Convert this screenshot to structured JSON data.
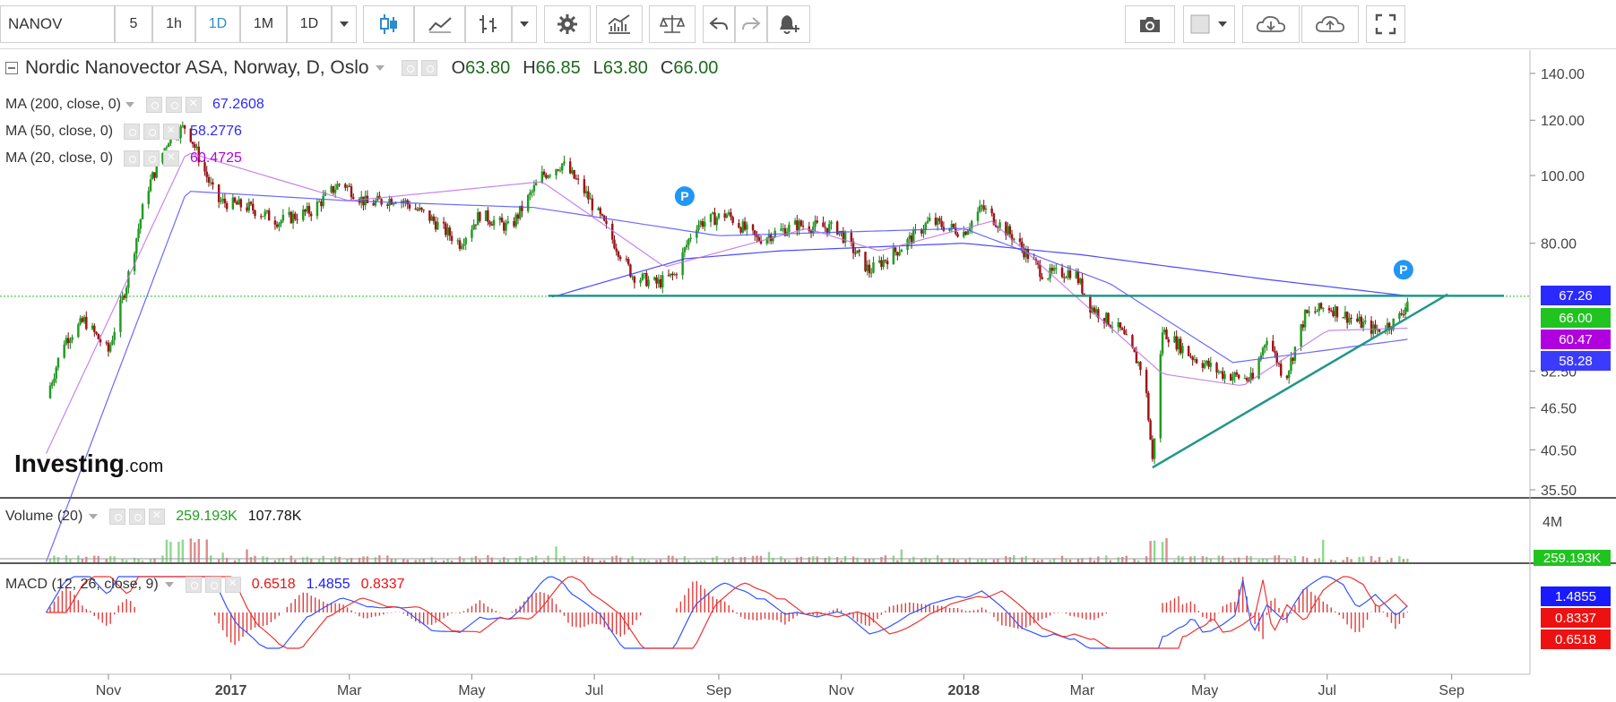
{
  "toolbar": {
    "symbol": "NANOV",
    "intervals": [
      "5",
      "1h",
      "1D",
      "1M",
      "1D"
    ],
    "active_interval": "1D"
  },
  "header": {
    "title": "Nordic Nanovector ASA, Norway, D, Oslo",
    "o_label": "O",
    "o_value": "63.80",
    "h_label": "H",
    "h_value": "66.85",
    "l_label": "L",
    "l_value": "63.80",
    "c_label": "C",
    "c_value": "66.00"
  },
  "indicators": {
    "ma200": {
      "label": "MA (200, close, 0)",
      "value": "67.2608",
      "color": "#2a2aff"
    },
    "ma50": {
      "label": "MA (50, close, 0)",
      "value": "58.2776",
      "color": "#2a2aff"
    },
    "ma20": {
      "label": "MA (20, close, 0)",
      "value": "60.4725",
      "color": "#b000e0"
    },
    "volume": {
      "label": "Volume (20)",
      "value1": "259.193K",
      "value2": "107.78K"
    },
    "macd": {
      "label": "MACD (12, 26, close, 9)",
      "value1": "0.6518",
      "value2": "1.4855",
      "value3": "0.8337"
    }
  },
  "price_tags": [
    {
      "text": "67.26",
      "bg": "#2a2aff"
    },
    {
      "text": "66.00",
      "bg": "#21c321"
    },
    {
      "text": "60.47",
      "bg": "#b000e0"
    },
    {
      "text": "58.28",
      "bg": "#3b3bff"
    }
  ],
  "volume_tag": {
    "text": "259.193K",
    "bg": "#21c321"
  },
  "macd_tags": [
    {
      "text": "1.4855",
      "bg": "#1a1aff"
    },
    {
      "text": "0.8337",
      "bg": "#ee1111"
    },
    {
      "text": "0.6518",
      "bg": "#ee1111"
    }
  ],
  "logo": {
    "brand": "Investing",
    "suffix": ".com"
  },
  "chart_data": {
    "type": "candlestick",
    "y_scale": "log",
    "y_ticks": [
      "140.00",
      "120.00",
      "100.00",
      "80.00",
      "52.50",
      "46.50",
      "40.50",
      "35.50"
    ],
    "x_ticks": [
      "Nov",
      "2017",
      "Mar",
      "May",
      "Jul",
      "Sep",
      "Nov",
      "2018",
      "Mar",
      "May",
      "Jul",
      "Sep"
    ],
    "volume_ticks": [
      "4M"
    ],
    "last": {
      "open": 63.8,
      "high": 66.85,
      "low": 63.8,
      "close": 66.0
    },
    "price_path": [
      [
        "2016-10-01",
        48
      ],
      [
        "2016-10-10",
        58
      ],
      [
        "2016-10-20",
        62
      ],
      [
        "2016-11-01",
        56
      ],
      [
        "2016-11-10",
        70
      ],
      [
        "2016-11-20",
        95
      ],
      [
        "2016-12-01",
        113
      ],
      [
        "2016-12-10",
        118
      ],
      [
        "2016-12-15",
        108
      ],
      [
        "2016-12-25",
        92
      ],
      [
        "2017-01-10",
        90
      ],
      [
        "2017-01-25",
        86
      ],
      [
        "2017-02-10",
        89
      ],
      [
        "2017-02-25",
        98
      ],
      [
        "2017-03-10",
        91
      ],
      [
        "2017-03-25",
        93
      ],
      [
        "2017-04-10",
        87
      ],
      [
        "2017-04-25",
        80
      ],
      [
        "2017-05-05",
        88
      ],
      [
        "2017-05-20",
        84
      ],
      [
        "2017-06-05",
        100
      ],
      [
        "2017-06-15",
        104
      ],
      [
        "2017-06-25",
        96
      ],
      [
        "2017-07-05",
        86
      ],
      [
        "2017-07-20",
        72
      ],
      [
        "2017-08-01",
        70
      ],
      [
        "2017-08-10",
        72
      ],
      [
        "2017-08-20",
        85
      ],
      [
        "2017-09-05",
        88
      ],
      [
        "2017-09-20",
        81
      ],
      [
        "2017-10-10",
        85
      ],
      [
        "2017-10-30",
        84
      ],
      [
        "2017-11-15",
        73
      ],
      [
        "2017-12-01",
        79
      ],
      [
        "2017-12-15",
        86
      ],
      [
        "2018-01-01",
        83
      ],
      [
        "2018-01-10",
        90
      ],
      [
        "2018-01-25",
        82
      ],
      [
        "2018-02-10",
        72
      ],
      [
        "2018-02-25",
        73
      ],
      [
        "2018-03-05",
        65
      ],
      [
        "2018-03-20",
        60
      ],
      [
        "2018-04-01",
        52
      ],
      [
        "2018-04-05",
        39
      ],
      [
        "2018-04-10",
        60
      ],
      [
        "2018-04-25",
        55
      ],
      [
        "2018-05-10",
        52
      ],
      [
        "2018-05-25",
        51
      ],
      [
        "2018-06-01",
        59
      ],
      [
        "2018-06-10",
        51
      ],
      [
        "2018-06-20",
        63
      ],
      [
        "2018-07-01",
        65
      ],
      [
        "2018-07-15",
        62
      ],
      [
        "2018-07-25",
        60
      ],
      [
        "2018-08-05",
        62
      ],
      [
        "2018-08-10",
        66
      ]
    ],
    "ma200_path": [
      [
        "2017-06-10",
        67
      ],
      [
        "2017-08-15",
        76
      ],
      [
        "2017-10-01",
        78
      ],
      [
        "2018-01-01",
        80
      ],
      [
        "2018-03-01",
        77
      ],
      [
        "2018-06-01",
        71
      ],
      [
        "2018-08-10",
        67.26
      ]
    ],
    "ma50_path": [
      [
        "2016-10-01",
        28
      ],
      [
        "2016-12-10",
        95
      ],
      [
        "2017-03-01",
        92
      ],
      [
        "2017-06-01",
        90
      ],
      [
        "2017-09-01",
        82
      ],
      [
        "2018-01-01",
        84
      ],
      [
        "2018-03-15",
        70
      ],
      [
        "2018-05-15",
        54
      ],
      [
        "2018-08-10",
        58.28
      ]
    ],
    "ma20_path": [
      [
        "2016-10-01",
        40
      ],
      [
        "2016-12-10",
        108
      ],
      [
        "2017-03-01",
        92
      ],
      [
        "2017-06-05",
        98
      ],
      [
        "2017-08-05",
        74
      ],
      [
        "2017-10-15",
        84
      ],
      [
        "2017-11-20",
        78
      ],
      [
        "2018-01-15",
        86
      ],
      [
        "2018-04-10",
        52
      ],
      [
        "2018-05-20",
        50
      ],
      [
        "2018-07-01",
        60
      ],
      [
        "2018-08-10",
        60.47
      ]
    ],
    "annotations": {
      "horizontal_resistance": 67.26,
      "trend_line_from": [
        "2018-04-05",
        38.2
      ],
      "trend_line_to": [
        "2018-08-30",
        67.6
      ]
    }
  }
}
